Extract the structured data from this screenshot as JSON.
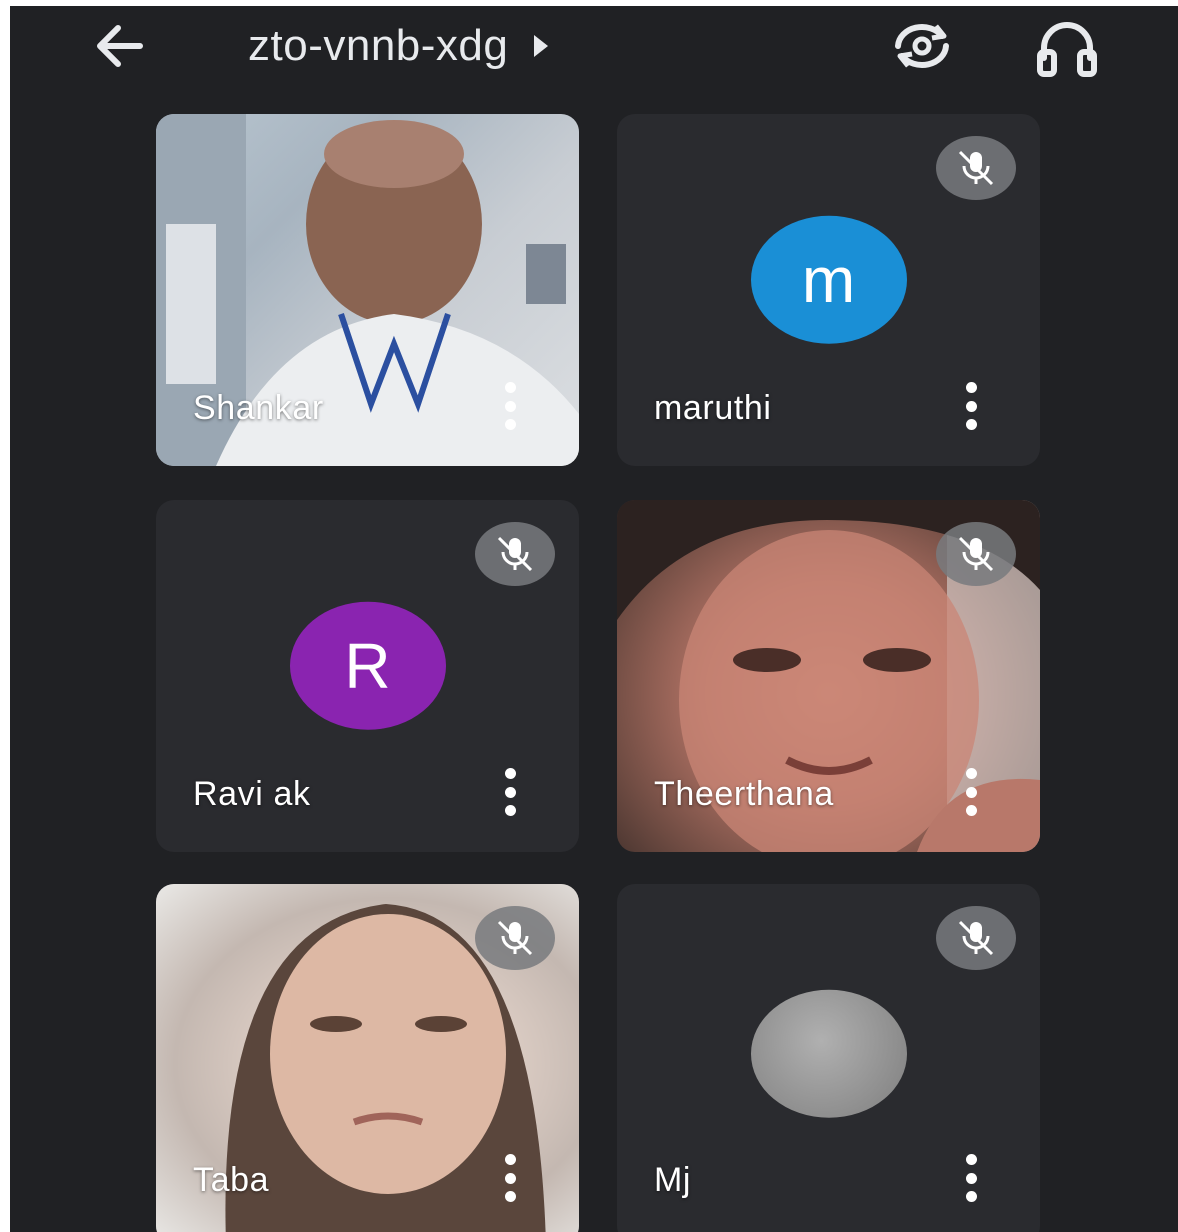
{
  "header": {
    "meeting_code": "zto-vnnb-xdg",
    "back_icon": "arrow-left-icon",
    "switch_camera_icon": "camera-switch-icon",
    "audio_icon": "headphones-icon"
  },
  "participants": [
    {
      "name": "Shankar",
      "video": true,
      "muted": false
    },
    {
      "name": "maruthi",
      "avatar_letter": "m",
      "avatar_color": "#1a8fd6",
      "video": false,
      "muted": true
    },
    {
      "name": "Ravi ak",
      "avatar_letter": "R",
      "avatar_color": "#8a24b0",
      "video": false,
      "muted": true
    },
    {
      "name": "Theerthana",
      "video": true,
      "muted": true
    },
    {
      "name": "Taba",
      "video": true,
      "muted": true
    },
    {
      "name": "Mj",
      "avatar_letter": "",
      "avatar_color": "#8e8e8e",
      "video": false,
      "muted": true
    }
  ],
  "colors": {
    "background": "#202124",
    "tile": "#2a2b2f",
    "mute_badge": "#787a7e"
  }
}
